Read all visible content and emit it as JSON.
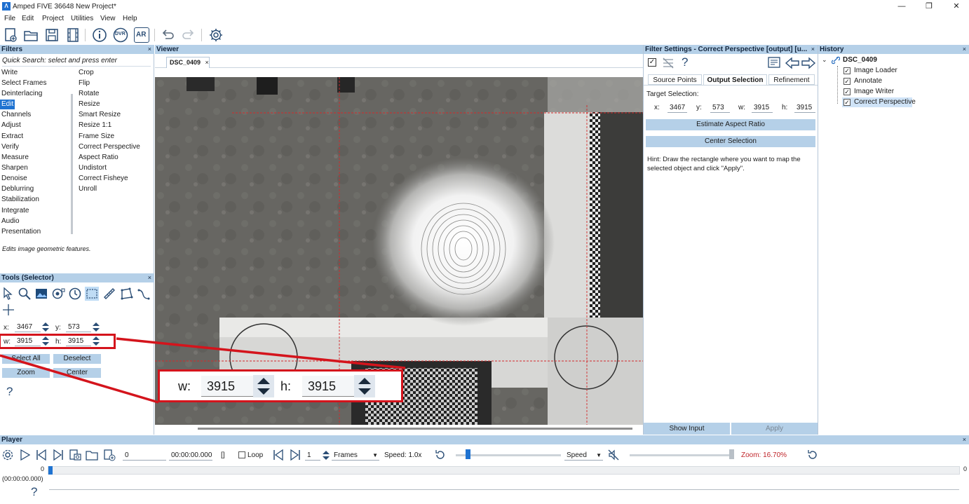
{
  "window": {
    "title": "Amped FIVE 36648   New Project*",
    "logo_text": "Λ",
    "controls": [
      "—",
      "❐",
      "✕"
    ]
  },
  "menu": [
    "File",
    "Edit",
    "Project",
    "Utilities",
    "View",
    "Help"
  ],
  "toolbar": {
    "icons": [
      "new-project-icon",
      "open-project-icon",
      "save-project-icon",
      "film-icon",
      "info-icon",
      "dvr-icon",
      "ar-icon",
      "undo-icon",
      "redo-icon",
      "settings-icon"
    ],
    "dvr_label": "DVR",
    "ar_label": "AR"
  },
  "filters": {
    "header": "Filters",
    "close": "×",
    "quick_search": "Quick Search: select and press enter",
    "categories": [
      "Write",
      "Select Frames",
      "Deinterlacing",
      "Edit",
      "Channels",
      "Adjust",
      "Extract",
      "Verify",
      "Measure",
      "Sharpen",
      "Denoise",
      "Deblurring",
      "Stabilization",
      "Integrate",
      "Audio",
      "Presentation"
    ],
    "selected_category": "Edit",
    "items": [
      "Crop",
      "Flip",
      "Rotate",
      "Resize",
      "Smart Resize",
      "Resize 1:1",
      "Frame Size",
      "Correct Perspective",
      "Aspect Ratio",
      "Undistort",
      "Correct Fisheye",
      "Unroll"
    ],
    "description": "Edits image geometric features."
  },
  "tools": {
    "header": "Tools (Selector)",
    "close": "×",
    "x_label": "x:",
    "x_value": "3467",
    "y_label": "y:",
    "y_value": "573",
    "w_label": "w:",
    "w_value": "3915",
    "h_label": "h:",
    "h_value": "3915",
    "select_all": "Select All",
    "deselect": "Deselect",
    "zoom": "Zoom",
    "center": "Center",
    "help": "?"
  },
  "viewer": {
    "header": "Viewer",
    "tab_label": "DSC_0409",
    "tab_close": "×"
  },
  "callout": {
    "w_label": "w:",
    "w_value": "3915",
    "h_label": "h:",
    "h_value": "3915"
  },
  "filter_settings": {
    "header": "Filter Settings - Correct Perspective [output] [u...",
    "close": "×",
    "help": "?",
    "tabs": [
      "Source Points",
      "Output Selection",
      "Refinement"
    ],
    "active_tab": "Output Selection",
    "target_label": "Target Selection:",
    "x_label": "x:",
    "x_value": "3467",
    "y_label": "y:",
    "y_value": "573",
    "w_label": "w:",
    "w_value": "3915",
    "h_label": "h:",
    "h_value": "3915",
    "estimate_button": "Estimate Aspect Ratio",
    "center_button": "Center Selection",
    "hint": "Hint: Draw the rectangle where you want to map the selected object and click \"Apply\".",
    "show_input": "Show Input",
    "apply": "Apply"
  },
  "history": {
    "header": "History",
    "close": "×",
    "root": "DSC_0409",
    "items": [
      {
        "label": "Image Loader",
        "checked": true
      },
      {
        "label": "Annotate",
        "checked": true
      },
      {
        "label": "Image Writer",
        "checked": true
      },
      {
        "label": "Correct Perspective",
        "checked": true
      }
    ]
  },
  "player": {
    "header": "Player",
    "close": "×",
    "frame_value": "0",
    "time_value": "00:00:00.000",
    "brackets": "[]",
    "loop_label": "Loop",
    "step_value": "1",
    "unit_select": "Frames",
    "speed_text": "Speed: 1.0x",
    "speed_select": "Speed",
    "zoom_text": "Zoom: 16.70%",
    "slider_start": "0",
    "slider_end": "0",
    "timestamp": "(00:00:00.000)",
    "help": "?"
  },
  "colors": {
    "panel_header": "#b5d0e8",
    "selection_blue": "#1f73d1",
    "callout_red": "#d4141c",
    "zoom_text_red": "#c0262b"
  }
}
